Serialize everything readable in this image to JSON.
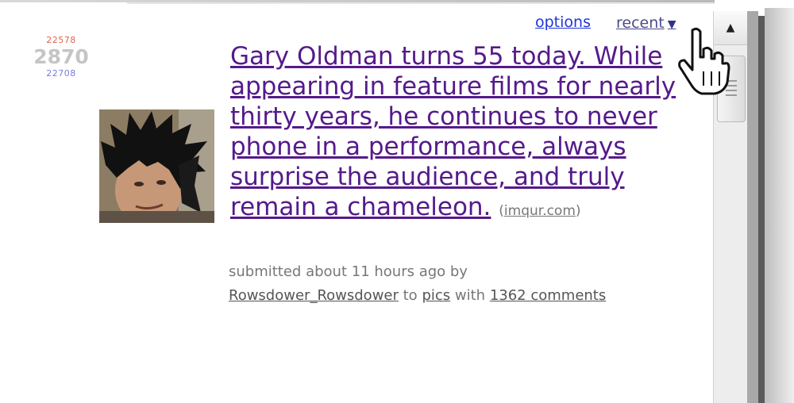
{
  "topbar": {
    "options_label": "options",
    "recent_label": "recent",
    "recent_arrow": "▼"
  },
  "post": {
    "score_up": "22578",
    "score": "2870",
    "score_down": "22708",
    "title": "Gary Oldman turns 55 today. While appearing in feature films for nearly thirty years, he continues to never phone in a performance, always surprise the audience, and truly remain a chameleon.",
    "domain": "imqur.com",
    "submitted_prefix": "submitted about 11 hours ago by",
    "author": "Rowsdower_Rowsdower",
    "to_text": "to",
    "subreddit": "pics",
    "with_text": "with",
    "comments_label": "1362 comments"
  },
  "icons": {
    "scroll_up": "scroll-up-arrow-icon",
    "cursor": "hand-pointer-icon",
    "thumbnail": "post-thumbnail-image"
  }
}
